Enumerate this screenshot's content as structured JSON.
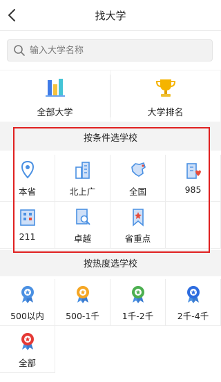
{
  "header": {
    "title": "找大学"
  },
  "search": {
    "placeholder": "输入大学名称"
  },
  "features": [
    {
      "label": "全部大学",
      "icon": "bar-chart-icon"
    },
    {
      "label": "大学排名",
      "icon": "trophy-icon"
    }
  ],
  "condition_section": {
    "title": "按条件选学校",
    "items": [
      {
        "label": "本省",
        "icon": "location-pin-icon"
      },
      {
        "label": "北上广",
        "icon": "city-buildings-icon"
      },
      {
        "label": "全国",
        "icon": "china-map-icon"
      },
      {
        "label": "985",
        "icon": "building-heart-icon"
      },
      {
        "label": "211",
        "icon": "office-building-icon"
      },
      {
        "label": "卓越",
        "icon": "document-search-icon"
      },
      {
        "label": "省重点",
        "icon": "bookmark-star-icon"
      }
    ]
  },
  "popularity_section": {
    "title": "按热度选学校",
    "items": [
      {
        "label": "500以内",
        "icon": "medal-blue-icon",
        "color": "#4a90e2"
      },
      {
        "label": "500-1千",
        "icon": "medal-orange-icon",
        "color": "#f5a623"
      },
      {
        "label": "1千-2千",
        "icon": "medal-green-icon",
        "color": "#4caf50"
      },
      {
        "label": "2千-4千",
        "icon": "medal-darkblue-icon",
        "color": "#2d6cdf"
      },
      {
        "label": "全部",
        "icon": "medal-red-icon",
        "color": "#e53935"
      }
    ]
  },
  "colors": {
    "accent": "#4a90e2",
    "highlight": "#e02020"
  }
}
